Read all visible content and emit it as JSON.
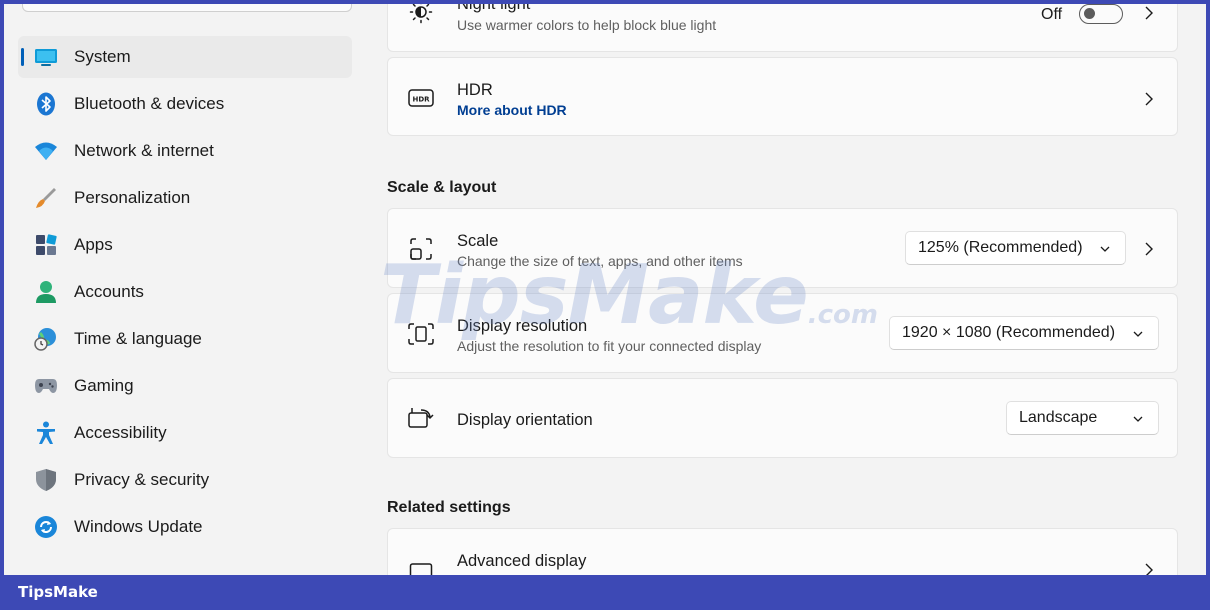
{
  "sidebar": {
    "items": [
      {
        "label": "System",
        "icon": "monitor-icon",
        "active": true
      },
      {
        "label": "Bluetooth & devices",
        "icon": "bluetooth-icon"
      },
      {
        "label": "Network & internet",
        "icon": "wifi-icon"
      },
      {
        "label": "Personalization",
        "icon": "brush-icon"
      },
      {
        "label": "Apps",
        "icon": "apps-icon"
      },
      {
        "label": "Accounts",
        "icon": "person-icon"
      },
      {
        "label": "Time & language",
        "icon": "globe-clock-icon"
      },
      {
        "label": "Gaming",
        "icon": "gamepad-icon"
      },
      {
        "label": "Accessibility",
        "icon": "accessibility-icon"
      },
      {
        "label": "Privacy & security",
        "icon": "shield-icon"
      },
      {
        "label": "Windows Update",
        "icon": "update-icon"
      }
    ]
  },
  "main": {
    "night_light": {
      "title": "Night light",
      "subtitle": "Use warmer colors to help block blue light",
      "state": "Off"
    },
    "hdr": {
      "title": "HDR",
      "link": "More about HDR"
    },
    "scale_layout": {
      "heading": "Scale & layout",
      "scale": {
        "title": "Scale",
        "subtitle": "Change the size of text, apps, and other items",
        "value": "125% (Recommended)"
      },
      "resolution": {
        "title": "Display resolution",
        "subtitle": "Adjust the resolution to fit your connected display",
        "value": "1920 × 1080 (Recommended)"
      },
      "orientation": {
        "title": "Display orientation",
        "value": "Landscape"
      }
    },
    "related": {
      "heading": "Related settings",
      "advanced_display": {
        "title": "Advanced display"
      }
    }
  },
  "watermark": {
    "text": "TipsMake",
    "domain": ".com"
  },
  "footer": {
    "brand": "TipsMake"
  },
  "colors": {
    "accent": "#005fb8",
    "frame": "#3d49b5",
    "link": "#003e92"
  }
}
